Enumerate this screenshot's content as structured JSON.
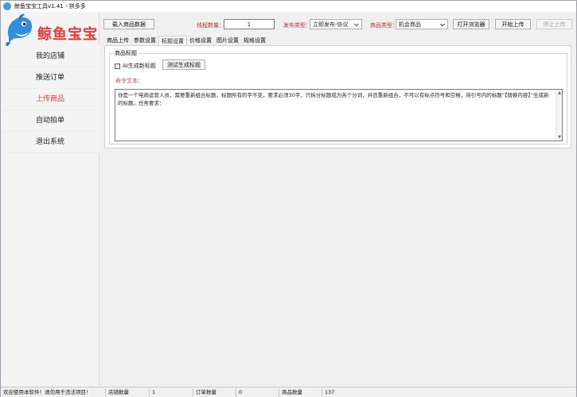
{
  "window": {
    "title": "鲸鱼宝宝工具v1.41 - 拼多多"
  },
  "sidebar": {
    "logo_text": "鲸鱼宝宝",
    "items": [
      {
        "label": "我的店铺",
        "active": false
      },
      {
        "label": "推送订单",
        "active": false
      },
      {
        "label": "上传商品",
        "active": true
      },
      {
        "label": "自动拍单",
        "active": false
      },
      {
        "label": "退出系统",
        "active": false
      }
    ]
  },
  "toolbar": {
    "load_button": "载入商品数据",
    "threads_label": "线程数量：",
    "threads_value": "1",
    "publish_type_label": "发布类型：",
    "publish_type_value": "立即发布-协议",
    "product_type_label": "商品类型：",
    "product_type_value": "机会商品",
    "open_browser_button": "打开浏览器",
    "start_upload_button": "开始上传",
    "stop_upload_button": "停止上传"
  },
  "tabs": [
    {
      "label": "商品上传",
      "active": false
    },
    {
      "label": "参数设置",
      "active": false
    },
    {
      "label": "标题设置",
      "active": true
    },
    {
      "label": "价格设置",
      "active": false
    },
    {
      "label": "图片设置",
      "active": false
    },
    {
      "label": "规格设置",
      "active": false
    }
  ],
  "title_settings": {
    "group_title": "商品标题",
    "ai_checkbox_label": "AI生成新标题",
    "ai_checked": false,
    "test_button": "测试生成标题",
    "prompt_label": "命令文本：",
    "prompt_text": "你是一个电商运营人员，需要重新组合标题，标题所有的字不变，要求必须30字，只拆分标题成为各个分词，并且重新组合，不可以有标点符号和空格，将引号内的标题“【替换内容】”生成新的标题。任务要求："
  },
  "statusbar": {
    "notice": "欢迎使用本软件！请勿用于违法项目！",
    "shop_count_label": "店铺数量",
    "shop_count_value": "1",
    "order_count_label": "订单数量",
    "order_count_value": "0",
    "product_count_label": "商品数量",
    "product_count_value": "137"
  },
  "colors": {
    "accent_red": "#e83838",
    "label_red": "#c03030",
    "logo_blue": "#3a9be8"
  }
}
